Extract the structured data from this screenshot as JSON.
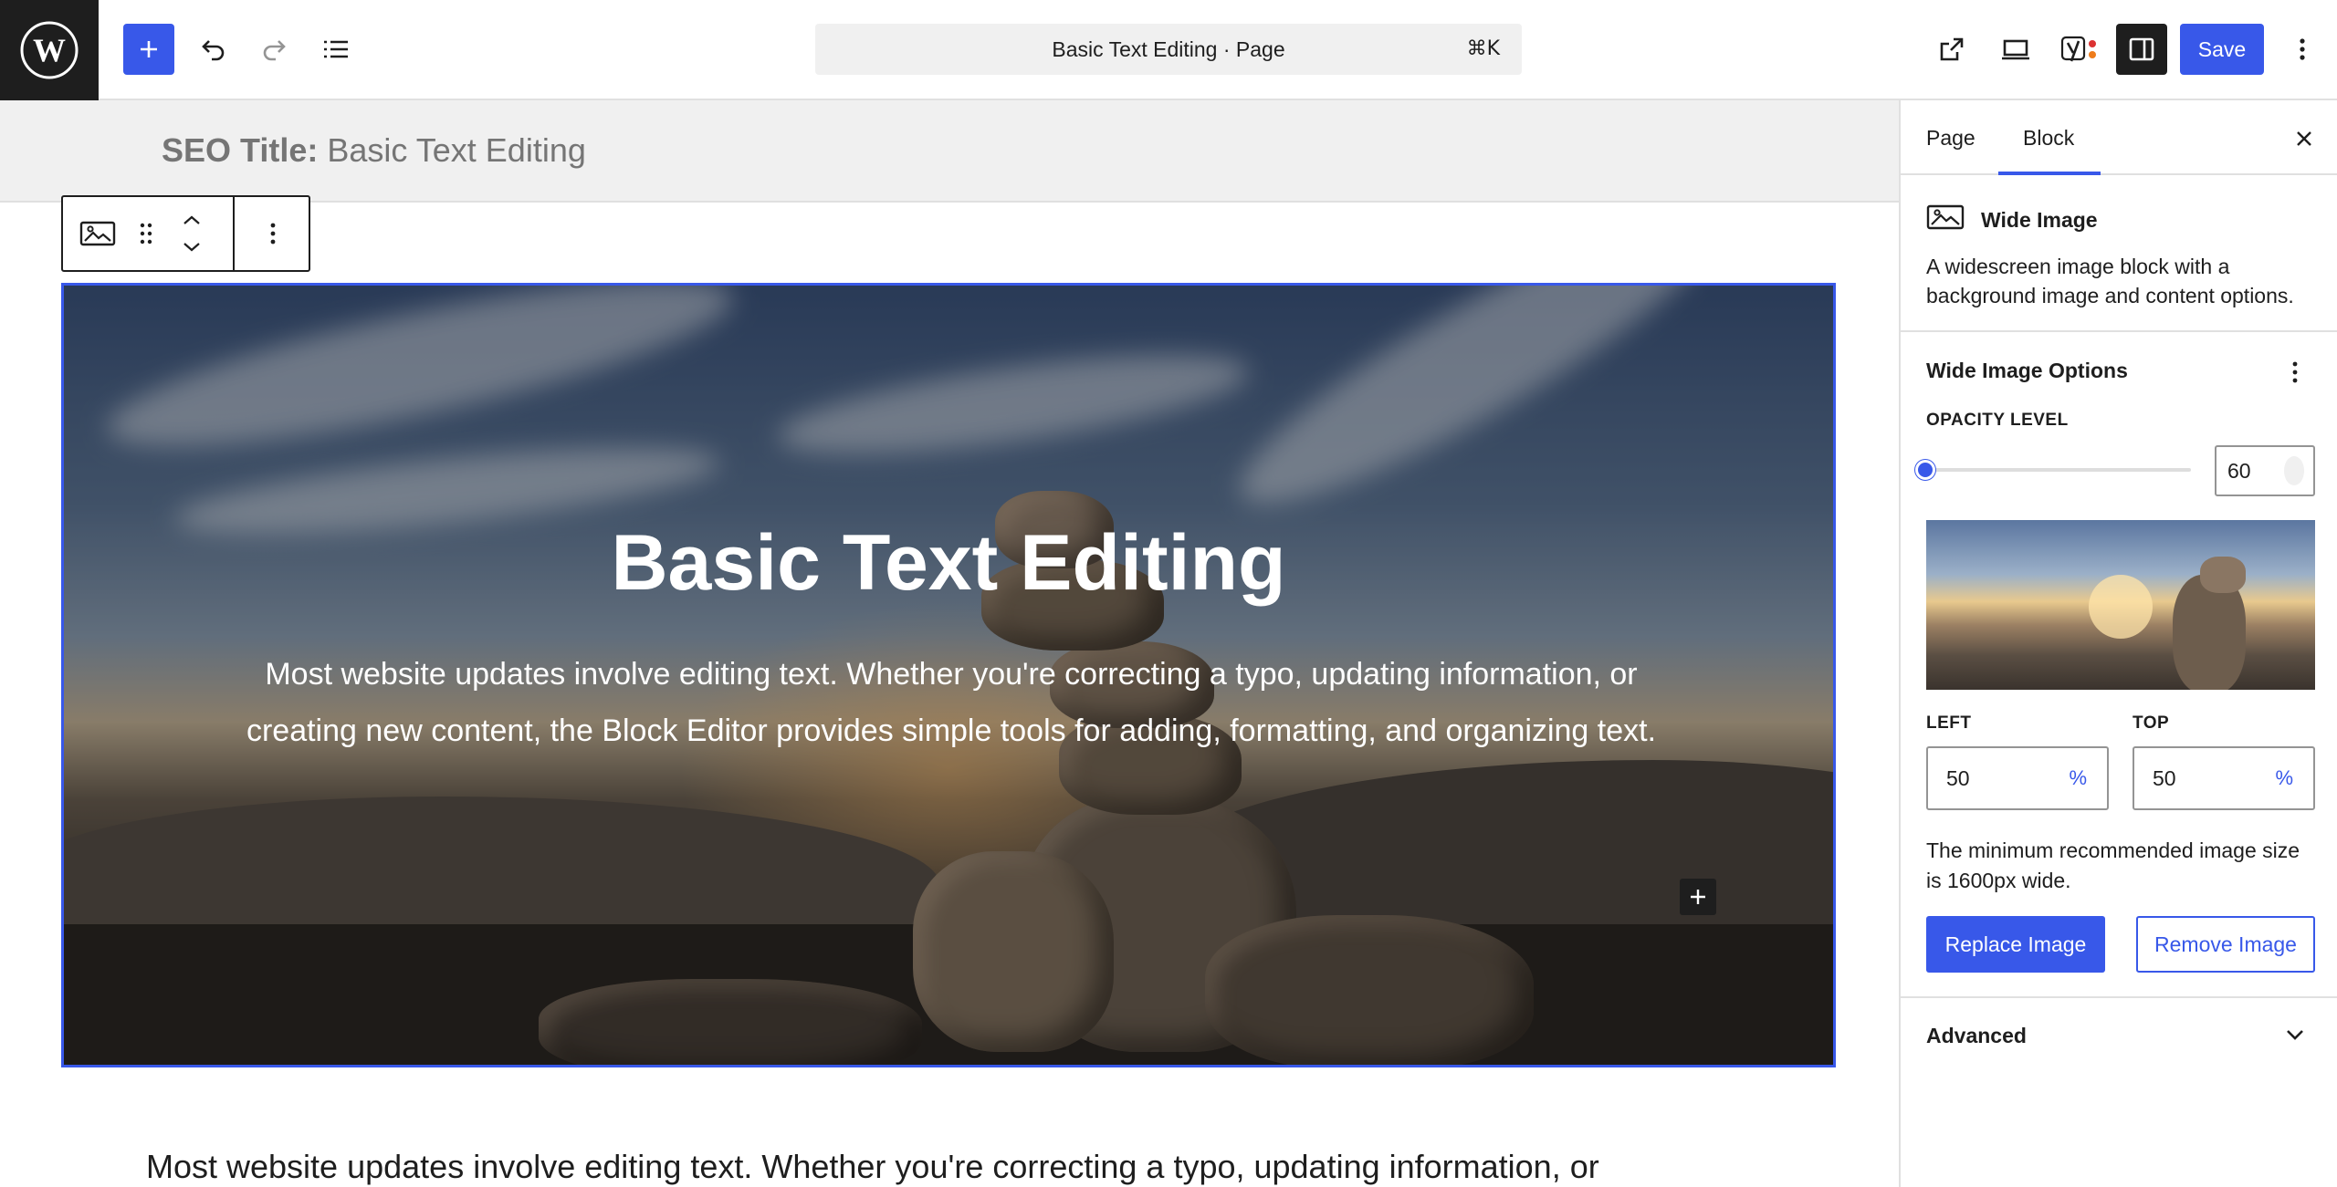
{
  "topbar": {
    "document_title": "Basic Text Editing · Page",
    "shortcut": "⌘K",
    "save_label": "Save",
    "colors": {
      "accent": "#3858e9",
      "dark": "#1e1e1e"
    }
  },
  "editor": {
    "seo_label": "SEO Title:",
    "seo_value": "Basic Text Editing",
    "cover_title": "Basic Text Editing",
    "cover_text": "Most website updates involve editing text. Whether you're correcting a typo, updating information, or creating new content, the Block Editor provides simple tools for adding, formatting, and organizing text.",
    "paragraph": "Most website updates involve editing text. Whether you're correcting a typo, updating information, or"
  },
  "sidebar": {
    "tabs": {
      "page": "Page",
      "block": "Block"
    },
    "active_tab": "Block",
    "block_card": {
      "title": "Wide Image",
      "description": "A widescreen image block with a background image and content options."
    },
    "panel_title": "Wide Image Options",
    "opacity_label": "OPACITY LEVEL",
    "opacity_value": "60",
    "opacity_fraction": 0.0,
    "left_label": "LEFT",
    "left_value": "50",
    "top_label": "TOP",
    "top_value": "50",
    "unit": "%",
    "note": "The minimum recommended image size is 1600px wide.",
    "replace_label": "Replace Image",
    "remove_label": "Remove Image",
    "advanced_label": "Advanced"
  }
}
